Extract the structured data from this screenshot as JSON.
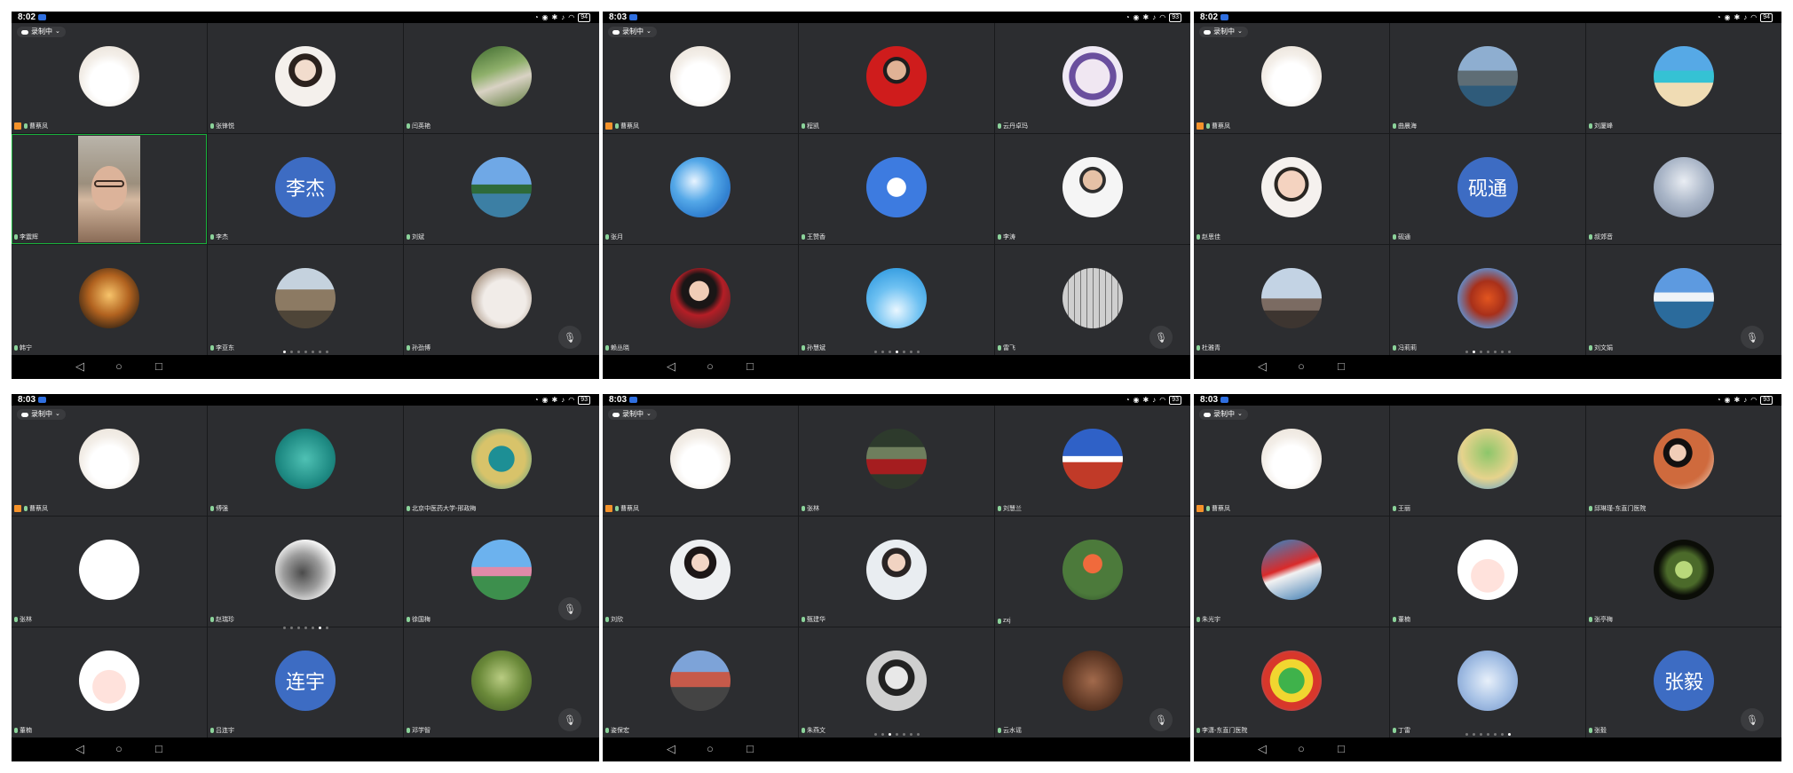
{
  "colors": {
    "tile": "#2c2d30",
    "active_border": "#19b23c",
    "text_avatar": "#3d6cc3",
    "host_badge": "#f5922a"
  },
  "screens": [
    {
      "time": "8:02",
      "battery": "94",
      "recording": "录制中",
      "active_page": 1,
      "mic_row": 3,
      "tiles": [
        {
          "name": "曹蔡凤",
          "avatar": "sketch-girl",
          "host": true
        },
        {
          "name": "张锋悦",
          "avatar": "woman-portrait"
        },
        {
          "name": "闫英艳",
          "avatar": "garden-photo"
        },
        {
          "name": "李震辉",
          "avatar": "video",
          "active": true
        },
        {
          "name": "李杰",
          "avatar": "text",
          "avatar_text": "李杰"
        },
        {
          "name": "刘斌",
          "avatar": "lake-photo"
        },
        {
          "name": "韩宁",
          "avatar": "autumn-tree"
        },
        {
          "name": "李亚东",
          "avatar": "city-photo"
        },
        {
          "name": "孙劲博",
          "avatar": "cat-photo"
        }
      ]
    },
    {
      "time": "8:03",
      "battery": "93",
      "recording": "录制中",
      "active_page": 4,
      "mic_row": 3,
      "tiles": [
        {
          "name": "曹蔡凤",
          "avatar": "sketch-girl",
          "host": true
        },
        {
          "name": "程凯",
          "avatar": "man-portrait"
        },
        {
          "name": "云丹卓玛",
          "avatar": "emblem"
        },
        {
          "name": "张月",
          "avatar": "blossom-photo"
        },
        {
          "name": "王赞香",
          "avatar": "dove-photo"
        },
        {
          "name": "李涛",
          "avatar": "doctor-portrait"
        },
        {
          "name": "赖丛晓",
          "avatar": "singer-portrait"
        },
        {
          "name": "孙慧斌",
          "avatar": "blue-sky"
        },
        {
          "name": "雷飞",
          "avatar": "calligraphy"
        }
      ]
    },
    {
      "time": "8:02",
      "battery": "94",
      "recording": "录制中",
      "active_page": 2,
      "mic_row": 3,
      "tiles": [
        {
          "name": "曹蔡凤",
          "avatar": "sketch-girl",
          "host": true
        },
        {
          "name": "曲晨海",
          "avatar": "island-photo"
        },
        {
          "name": "刘厦峰",
          "avatar": "beach-photo"
        },
        {
          "name": "赵思佳",
          "avatar": "baby-photo"
        },
        {
          "name": "砚通",
          "avatar": "text",
          "avatar_text": "砚通"
        },
        {
          "name": "叔郊音",
          "avatar": "cloud-sky"
        },
        {
          "name": "杜雅青",
          "avatar": "sunset-sky"
        },
        {
          "name": "冯莉莉",
          "avatar": "autumn-leaves"
        },
        {
          "name": "刘文娟",
          "avatar": "lake-sky"
        }
      ]
    },
    {
      "time": "8:03",
      "battery": "93",
      "recording": "录制中",
      "active_page": 6,
      "mic_row": 2,
      "mic_row2": 3,
      "tiles": [
        {
          "name": "曹蔡凤",
          "avatar": "sketch-girl",
          "host": true
        },
        {
          "name": "傅强",
          "avatar": "dolphin-photo"
        },
        {
          "name": "北京中医药大学-邢政梅",
          "avatar": "tree-photo"
        },
        {
          "name": "张林",
          "avatar": "white-blank"
        },
        {
          "name": "赵瑞珍",
          "avatar": "ink-painting"
        },
        {
          "name": "徐国梅",
          "avatar": "tower-photo"
        },
        {
          "name": "董楠",
          "avatar": "cartoon-girl"
        },
        {
          "name": "吕连宇",
          "avatar": "text",
          "avatar_text": "连宇"
        },
        {
          "name": "邓学智",
          "avatar": "green-tree"
        }
      ]
    },
    {
      "time": "8:03",
      "battery": "93",
      "recording": "录制中",
      "active_page": 3,
      "mic_row": 3,
      "tiles": [
        {
          "name": "曹蔡凤",
          "avatar": "sketch-girl",
          "host": true
        },
        {
          "name": "张林",
          "avatar": "red-dress"
        },
        {
          "name": "刘慧兰",
          "avatar": "palace-photo"
        },
        {
          "name": "刘欣",
          "avatar": "white-gown-portrait"
        },
        {
          "name": "甄建华",
          "avatar": "white-shirt-portrait"
        },
        {
          "name": "zxj",
          "avatar": "strawberry-photo"
        },
        {
          "name": "姿保宏",
          "avatar": "kids-photo"
        },
        {
          "name": "朱燕文",
          "avatar": "bw-portrait"
        },
        {
          "name": "云水谣",
          "avatar": "carved-stone"
        }
      ]
    },
    {
      "time": "8:03",
      "battery": "93",
      "recording": "录制中",
      "active_page": 7,
      "mic_row": 3,
      "tiles": [
        {
          "name": "曹蔡凤",
          "avatar": "sketch-girl",
          "host": true
        },
        {
          "name": "王丽",
          "avatar": "painted-tree"
        },
        {
          "name": "邱琳瑾-东直门医院",
          "avatar": "reader-portrait"
        },
        {
          "name": "朱光宇",
          "avatar": "red-car"
        },
        {
          "name": "董楠",
          "avatar": "cartoon-girl"
        },
        {
          "name": "张亭梅",
          "avatar": "flower-bud"
        },
        {
          "name": "李潇-东直门医院",
          "avatar": "kids-drawing"
        },
        {
          "name": "丁雷",
          "avatar": "frost-flowers"
        },
        {
          "name": "张毅",
          "avatar": "text",
          "avatar_text": "张毅"
        }
      ]
    }
  ]
}
